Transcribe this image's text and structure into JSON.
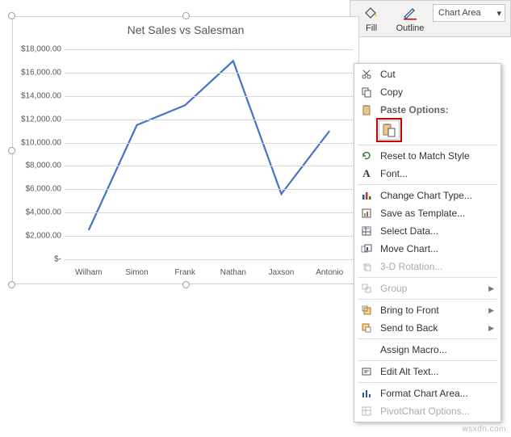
{
  "ribbon": {
    "fill_label": "Fill",
    "outline_label": "Outline",
    "selector_value": "Chart Area"
  },
  "chart_data": {
    "type": "line",
    "title": "Net Sales vs Salesman",
    "categories": [
      "Wilham",
      "Simon",
      "Frank",
      "Nathan",
      "Jaxson",
      "Antonio"
    ],
    "values": [
      2500,
      11500,
      13200,
      17000,
      5600,
      11000
    ],
    "y_ticks": [
      "$-",
      "$2,000.00",
      "$4,000.00",
      "$6,000.00",
      "$8,000.00",
      "$10,000.00",
      "$12,000.00",
      "$14,000.00",
      "$16,000.00",
      "$18,000.00"
    ],
    "ylim": [
      0,
      18000
    ],
    "xlabel": "",
    "ylabel": ""
  },
  "context_menu": {
    "cut": "Cut",
    "copy": "Copy",
    "paste_options_header": "Paste Options:",
    "reset": "Reset to Match Style",
    "font": "Font...",
    "change_type": "Change Chart Type...",
    "save_template": "Save as Template...",
    "select_data": "Select Data...",
    "move_chart": "Move Chart...",
    "rotation": "3-D Rotation...",
    "group": "Group",
    "bring_front": "Bring to Front",
    "send_back": "Send to Back",
    "assign_macro": "Assign Macro...",
    "alt_text": "Edit Alt Text...",
    "format_area": "Format Chart Area...",
    "pivot_options": "PivotChart Options..."
  },
  "watermark": "wsxdn.com"
}
